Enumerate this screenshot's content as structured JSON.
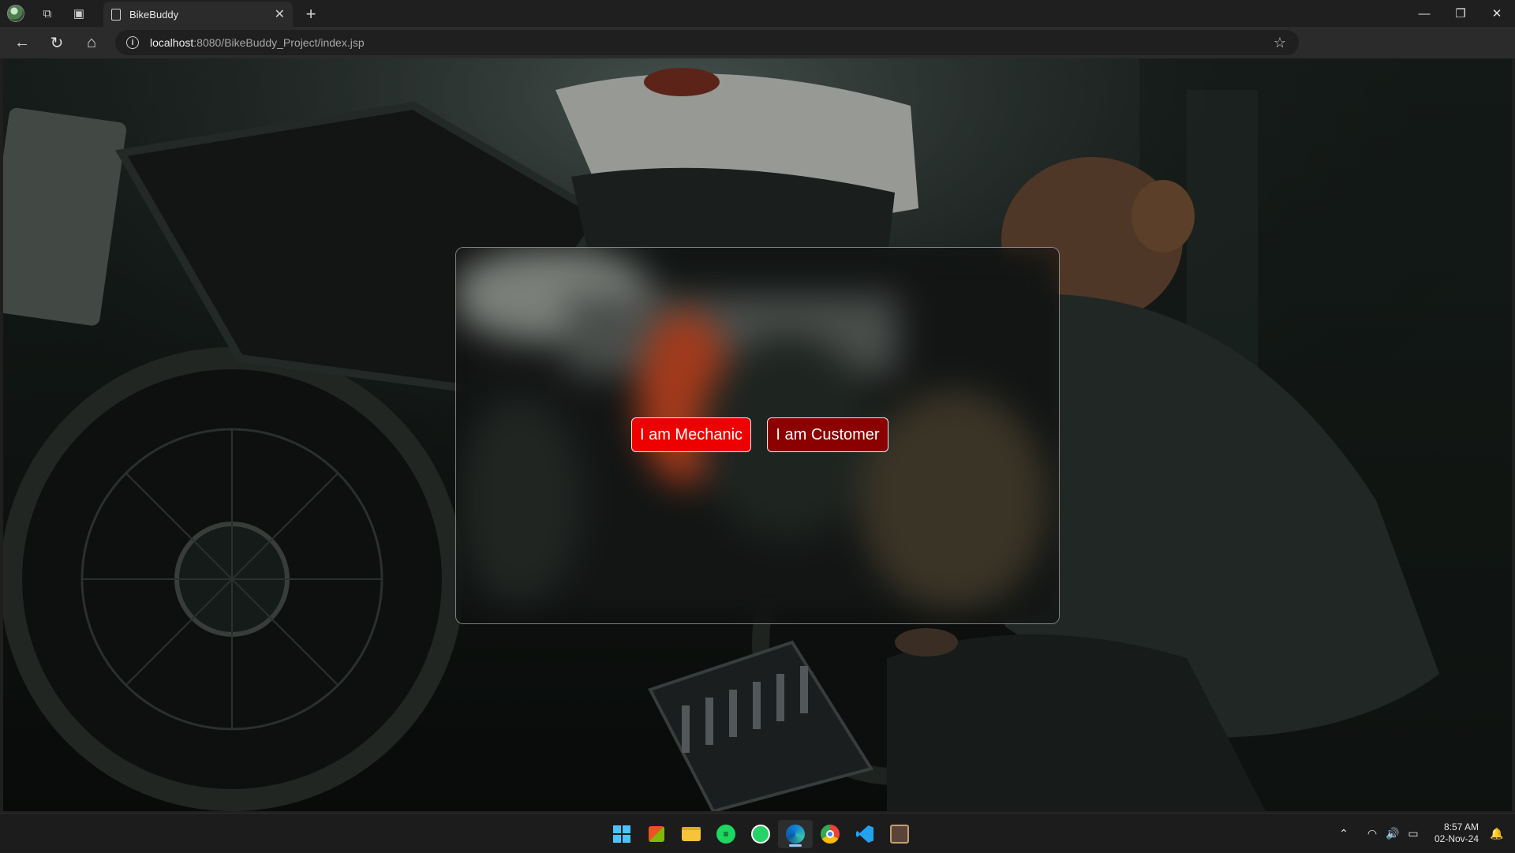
{
  "browser": {
    "tab_title": "BikeBuddy",
    "url_host": "localhost",
    "url_rest": ":8080/BikeBuddy_Project/index.jsp"
  },
  "page": {
    "mechanic_button": "I am Mechanic",
    "customer_button": "I am Customer"
  },
  "taskbar": {
    "time": "8:57 AM",
    "date": "02-Nov-24"
  },
  "colors": {
    "mechanic_button_bg": "#ef0000",
    "customer_button_bg": "#8b0000",
    "chrome_bg": "#1f1f1f"
  }
}
